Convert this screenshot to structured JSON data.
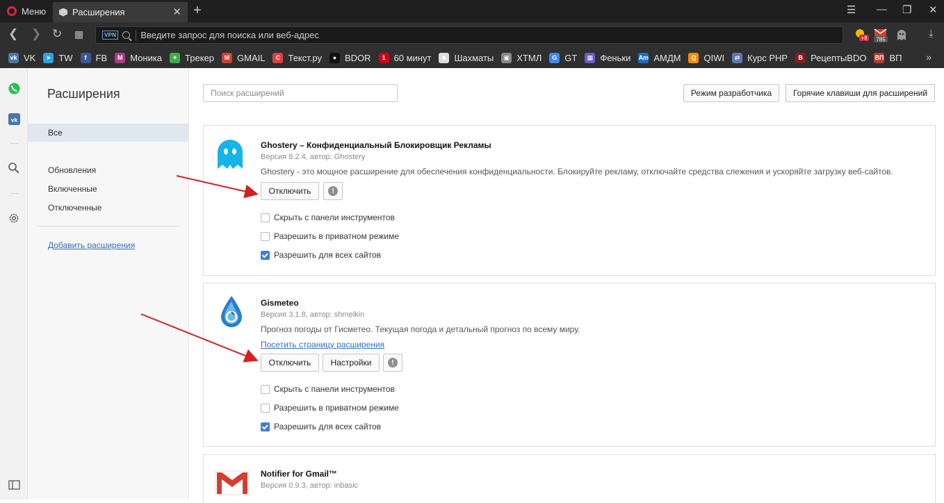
{
  "browser": {
    "menu_label": "Меню",
    "tab_title": "Расширения",
    "address_placeholder": "Введите запрос для поиска или веб-адрес",
    "vpn_badge": "VPN",
    "badge_plus": "+8",
    "mail_count": "785",
    "accent": "#e0243a"
  },
  "bookmarks": [
    {
      "label": "VK",
      "icon": "vk-icon",
      "color": "#4a76a8"
    },
    {
      "label": "TW",
      "icon": "telegram-icon",
      "color": "#2ca5e0"
    },
    {
      "label": "FB",
      "icon": "facebook-icon",
      "color": "#3b5998"
    },
    {
      "label": "Моника",
      "icon": "monika-icon",
      "color": "#b03a8c"
    },
    {
      "label": "Трекер",
      "icon": "tracker-icon",
      "color": "#3fae49"
    },
    {
      "label": "GMAIL",
      "icon": "gmail-icon",
      "color": "#d23f31"
    },
    {
      "label": "Текст.ру",
      "icon": "textru-icon",
      "color": "#e04040"
    },
    {
      "label": "BDOR",
      "icon": "bdor-icon",
      "color": "#111111"
    },
    {
      "label": "60 минут",
      "icon": "60min-icon",
      "color": "#d0021b"
    },
    {
      "label": "Шахматы",
      "icon": "chess-icon",
      "color": "#dddddd"
    },
    {
      "label": "ХТМЛ",
      "icon": "html-icon",
      "color": "#888888"
    },
    {
      "label": "GT",
      "icon": "google-translate-icon",
      "color": "#4285f4"
    },
    {
      "label": "Феньки",
      "icon": "fenki-icon",
      "color": "#6a5acd"
    },
    {
      "label": "АМДМ",
      "icon": "amdm-icon",
      "color": "#1e6fc4"
    },
    {
      "label": "QIWI",
      "icon": "qiwi-icon",
      "color": "#ff8c00"
    },
    {
      "label": "Курс PHP",
      "icon": "php-icon",
      "color": "#5a7ab0"
    },
    {
      "label": "РецептыBDO",
      "icon": "recipes-icon",
      "color": "#8b1a1a"
    },
    {
      "label": "ВП",
      "icon": "vp-icon",
      "color": "#c0392b"
    }
  ],
  "sidebar": {
    "title": "Расширения",
    "all": "Все",
    "items": [
      "Обновления",
      "Включенные",
      "Отключенные"
    ],
    "add_link": "Добавить расширения"
  },
  "main": {
    "search_placeholder": "Поиск расширений",
    "dev_mode": "Режим разработчика",
    "hotkeys": "Горячие клавиши для расширений"
  },
  "extensions": [
    {
      "name": "Ghostery – Конфиденциальный Блокировщик Рекламы",
      "version": "Версия 8.2.4, автор: Ghostery",
      "description": "Ghostery - это мощное расширение для обеспечения конфиденциальности. Блокируйте рекламу, отключайте средства слежения и ускоряйте загрузку веб-сайтов.",
      "disable_label": "Отключить",
      "options": [
        {
          "label": "Скрыть с панели инструментов",
          "checked": false
        },
        {
          "label": "Разрешить в приватном режиме",
          "checked": false
        },
        {
          "label": "Разрешить для всех сайтов",
          "checked": true
        }
      ]
    },
    {
      "name": "Gismeteo",
      "version": "Версия 3.1.8, автор: shmelkin",
      "description": "Прогноз погоды от Гисметео. Текущая погода и детальный прогноз по всему миру.",
      "link": "Посетить страницу расширения",
      "disable_label": "Отключить",
      "settings_label": "Настройки",
      "options": [
        {
          "label": "Скрыть с панели инструментов",
          "checked": false
        },
        {
          "label": "Разрешить в приватном режиме",
          "checked": false
        },
        {
          "label": "Разрешить для всех сайтов",
          "checked": true
        }
      ]
    },
    {
      "name": "Notifier for Gmail™",
      "version": "Версия 0.9.3, автор: inbasic"
    }
  ]
}
